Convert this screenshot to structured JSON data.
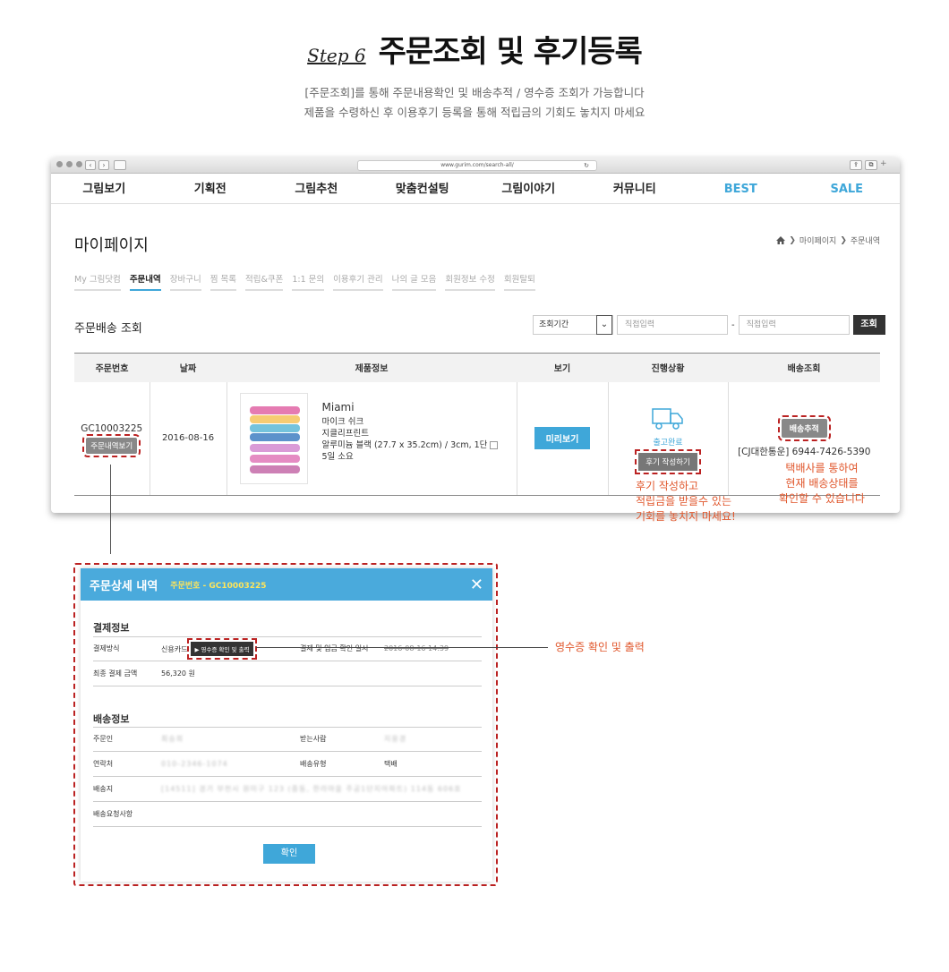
{
  "header": {
    "step": "Step 6",
    "title": "주문조회 및 후기등록",
    "desc1": "[주문조회]를 통해 주문내용확인 및 배송추적 / 영수증 조회가 가능합니다",
    "desc2": "제품을 수령하신 후 이용후기 등록을 통해 적립금의 기회도 놓치지 마세요"
  },
  "browser": {
    "url": "www.gurim.com/search-all/"
  },
  "gnb": [
    "그림보기",
    "기획전",
    "그림추천",
    "맞춤컨설팅",
    "그림이야기",
    "커뮤니티",
    "BEST",
    "SALE"
  ],
  "page": {
    "title": "마이페이지",
    "crumb1": "마이페이지",
    "crumb2": "주문내역"
  },
  "subtabs": [
    "My 그림닷컴",
    "주문내역",
    "장바구니",
    "찜 목록",
    "적립&쿠폰",
    "1:1 문의",
    "이용후기 관리",
    "나의 글 모음",
    "회원정보 수정",
    "회원탈퇴"
  ],
  "section": {
    "title": "주문배송 조회",
    "period": "조회기간",
    "input1": "직접입력",
    "input2": "직접입력",
    "search_btn": "조회"
  },
  "table": {
    "headers": [
      "주문번호",
      "날짜",
      "제품정보",
      "보기",
      "진행상황",
      "배송조회"
    ],
    "row": {
      "order_no": "GC10003225",
      "detail_btn": "주문내역보기",
      "date": "2016-08-16",
      "name": "Miami",
      "line1": "마이크 쉬크",
      "line2": "지클리프린트",
      "line3": "알루미늄 블랙 (27.7 x 35.2cm) / 3cm, 1단",
      "line4": "5일 소요",
      "preview": "미리보기",
      "status": "출고완료",
      "review": "후기 작성하기",
      "track": "배송추적",
      "tracking": "[CJ대한통운] 6944-7426-5390"
    }
  },
  "notes": {
    "review1": "후기 작성하고",
    "review2": "적립금을 받을수 있는",
    "review3": "기회를 놓치지 마세요!",
    "track1": "택배사를 통하여",
    "track2": "현재 배송상태를",
    "track3": "확인할 수 있습니다",
    "receipt": "영수증 확인 및 출력"
  },
  "modal": {
    "title": "주문상세 내역",
    "order": "주문번호 - GC10003225",
    "pay_title": "결제정보",
    "pay_method_k": "결제방식",
    "pay_method_v": "신용카드",
    "receipt_btn": "▶ 영수증 확인 및 출력",
    "pay_date_k": "결제 및 입금 확인 일시",
    "pay_date_v": "2016-08-16 14:39",
    "amount_k": "최종 결제 금액",
    "amount_v": "56,320 원",
    "ship_title": "배송정보",
    "orderer_k": "주문인",
    "orderer_v": "최승희",
    "receiver_k": "받는사람",
    "receiver_v": "지응경",
    "phone_k": "연락처",
    "phone_v": "010-2346-1074",
    "shiptype_k": "배송유형",
    "shiptype_v": "택배",
    "addr_k": "배송지",
    "addr_v": "[14511] 경기 부천시 원미구 123 (중동, 한라마을 주공1단지아파트) 114동 606호",
    "req_k": "배송요청사항",
    "ok": "확인"
  }
}
